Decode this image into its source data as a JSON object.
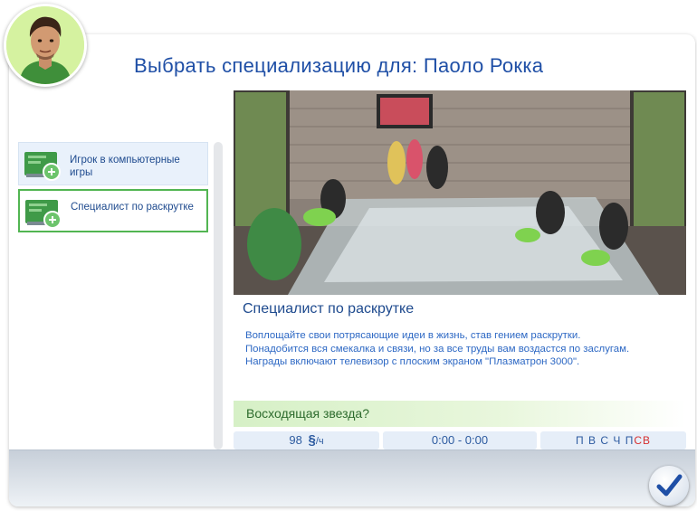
{
  "window": {
    "title": "Выбрать специализацию для: Паоло Рокка"
  },
  "branches": [
    {
      "label": "Игрок в компьютерные игры",
      "selected": false,
      "icon": "career-gaming-card-icon"
    },
    {
      "label": "Специалист по раскрутке",
      "selected": true,
      "icon": "career-marketing-card-icon"
    }
  ],
  "details": {
    "career_name": "Специалист по раскрутке",
    "description_lines": [
      "Воплощайте свои потрясающие идеи в жизнь, став гением раскрутки.",
      "Понадобится вся смекалка и связи, но за все труды вам воздастся по заслугам.",
      "Награды включают телевизор с плоским экраном \"Плазматрон 3000\"."
    ],
    "level_title": "Восходящая звезда?",
    "pay_value": "98",
    "currency_symbol": "§",
    "pay_unit": "/ч",
    "hours": "0:00 - 0:00",
    "days": [
      {
        "label": "П",
        "off": false
      },
      {
        "label": "В",
        "off": false
      },
      {
        "label": "С",
        "off": false
      },
      {
        "label": "Ч",
        "off": false
      },
      {
        "label": "П",
        "off": false
      },
      {
        "label": "С",
        "off": true
      },
      {
        "label": "В",
        "off": true
      }
    ]
  },
  "colors": {
    "title": "#1f4fa6",
    "selection_border": "#52b552",
    "weekend_day": "#d63030",
    "level_text": "#2d6b2d"
  },
  "icons": {
    "avatar": "sim-avatar",
    "confirm": "checkmark-icon"
  }
}
